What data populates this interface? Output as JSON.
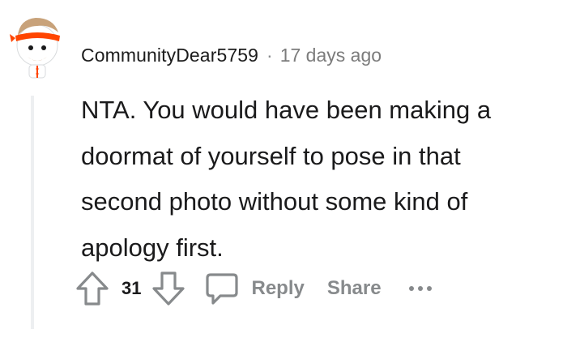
{
  "comment": {
    "author": "CommunityDear5759",
    "separator": "·",
    "timestamp": "17 days ago",
    "body_lines": [
      "NTA. You would have been making a",
      "doormat of yourself to pose in that",
      "second photo without some kind of",
      "apology first."
    ],
    "avatar_icon": "snoo-avatar-icon"
  },
  "actions": {
    "upvote_icon": "upvote-arrow-icon",
    "vote_count": "31",
    "downvote_icon": "downvote-arrow-icon",
    "reply_icon": "comment-bubble-icon",
    "reply_label": "Reply",
    "share_label": "Share",
    "more_icon": "more-options-icon"
  },
  "colors": {
    "text_primary": "#1a1a1b",
    "text_muted": "#878a8c",
    "thread_line": "#edeff1",
    "avatar_accent": "#ff4500"
  }
}
